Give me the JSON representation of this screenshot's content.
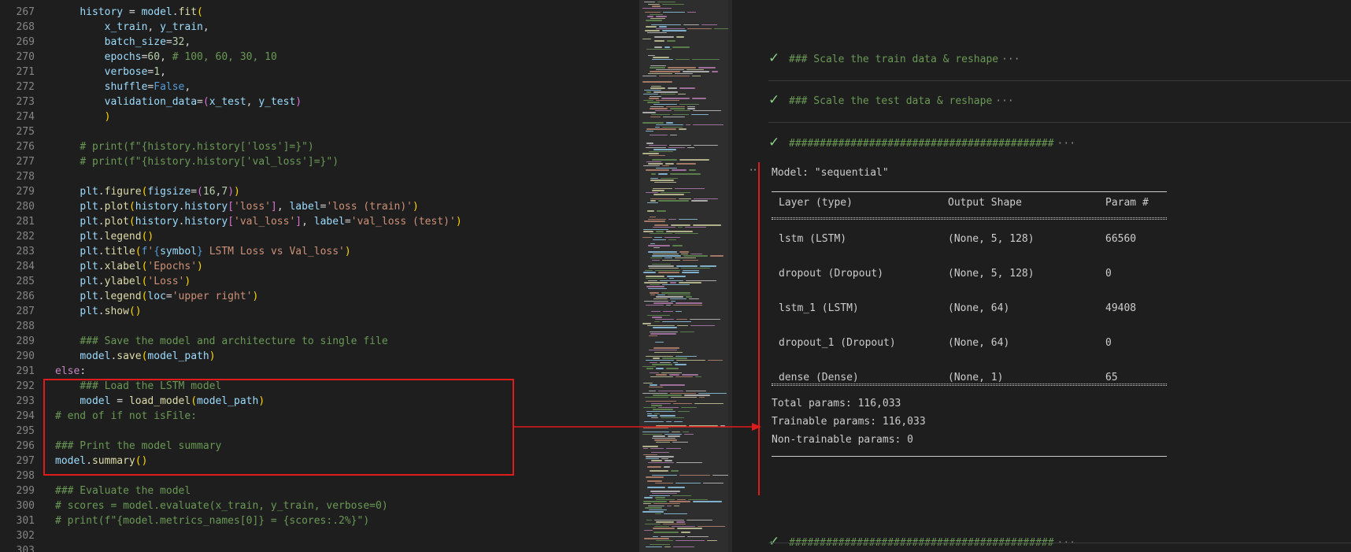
{
  "editor": {
    "lines": [
      {
        "n": "267",
        "tokens": [
          [
            "p",
            "    "
          ],
          [
            "var",
            "history"
          ],
          [
            "p",
            " = "
          ],
          [
            "var",
            "model"
          ],
          [
            "p",
            "."
          ],
          [
            "fn",
            "fit"
          ],
          [
            "br1",
            "("
          ]
        ]
      },
      {
        "n": "268",
        "tokens": [
          [
            "p",
            "        "
          ],
          [
            "var",
            "x_train"
          ],
          [
            "p",
            ", "
          ],
          [
            "var",
            "y_train"
          ],
          [
            "p",
            ","
          ]
        ]
      },
      {
        "n": "269",
        "tokens": [
          [
            "p",
            "        "
          ],
          [
            "var",
            "batch_size"
          ],
          [
            "p",
            "="
          ],
          [
            "num",
            "32"
          ],
          [
            "p",
            ","
          ]
        ]
      },
      {
        "n": "270",
        "tokens": [
          [
            "p",
            "        "
          ],
          [
            "var",
            "epochs"
          ],
          [
            "p",
            "="
          ],
          [
            "num",
            "60"
          ],
          [
            "p",
            ", "
          ],
          [
            "cm",
            "# 100, 60, 30, 10"
          ]
        ]
      },
      {
        "n": "271",
        "tokens": [
          [
            "p",
            "        "
          ],
          [
            "var",
            "verbose"
          ],
          [
            "p",
            "="
          ],
          [
            "num",
            "1"
          ],
          [
            "p",
            ","
          ]
        ]
      },
      {
        "n": "272",
        "tokens": [
          [
            "p",
            "        "
          ],
          [
            "var",
            "shuffle"
          ],
          [
            "p",
            "="
          ],
          [
            "const",
            "False"
          ],
          [
            "p",
            ","
          ]
        ]
      },
      {
        "n": "273",
        "tokens": [
          [
            "p",
            "        "
          ],
          [
            "var",
            "validation_data"
          ],
          [
            "p",
            "="
          ],
          [
            "br2",
            "("
          ],
          [
            "var",
            "x_test"
          ],
          [
            "p",
            ", "
          ],
          [
            "var",
            "y_test"
          ],
          [
            "br2",
            ")"
          ]
        ]
      },
      {
        "n": "274",
        "tokens": [
          [
            "p",
            "        "
          ],
          [
            "br1",
            ")"
          ]
        ]
      },
      {
        "n": "275",
        "tokens": []
      },
      {
        "n": "276",
        "tokens": [
          [
            "p",
            "    "
          ],
          [
            "cm",
            "# print(f\"{history.history['loss']=}\")"
          ]
        ]
      },
      {
        "n": "277",
        "tokens": [
          [
            "p",
            "    "
          ],
          [
            "cm",
            "# print(f\"{history.history['val_loss']=}\")"
          ]
        ]
      },
      {
        "n": "278",
        "tokens": []
      },
      {
        "n": "279",
        "tokens": [
          [
            "p",
            "    "
          ],
          [
            "var",
            "plt"
          ],
          [
            "p",
            "."
          ],
          [
            "fn",
            "figure"
          ],
          [
            "br1",
            "("
          ],
          [
            "var",
            "figsize"
          ],
          [
            "p",
            "="
          ],
          [
            "br2",
            "("
          ],
          [
            "num",
            "16"
          ],
          [
            "p",
            ","
          ],
          [
            "num",
            "7"
          ],
          [
            "br2",
            ")"
          ],
          [
            "br1",
            ")"
          ]
        ]
      },
      {
        "n": "280",
        "tokens": [
          [
            "p",
            "    "
          ],
          [
            "var",
            "plt"
          ],
          [
            "p",
            "."
          ],
          [
            "fn",
            "plot"
          ],
          [
            "br1",
            "("
          ],
          [
            "var",
            "history"
          ],
          [
            "p",
            "."
          ],
          [
            "var",
            "history"
          ],
          [
            "br2",
            "["
          ],
          [
            "str",
            "'loss'"
          ],
          [
            "br2",
            "]"
          ],
          [
            "p",
            ", "
          ],
          [
            "var",
            "label"
          ],
          [
            "p",
            "="
          ],
          [
            "str",
            "'loss (train)'"
          ],
          [
            "br1",
            ")"
          ]
        ]
      },
      {
        "n": "281",
        "tokens": [
          [
            "p",
            "    "
          ],
          [
            "var",
            "plt"
          ],
          [
            "p",
            "."
          ],
          [
            "fn",
            "plot"
          ],
          [
            "br1",
            "("
          ],
          [
            "var",
            "history"
          ],
          [
            "p",
            "."
          ],
          [
            "var",
            "history"
          ],
          [
            "br2",
            "["
          ],
          [
            "str",
            "'val_loss'"
          ],
          [
            "br2",
            "]"
          ],
          [
            "p",
            ", "
          ],
          [
            "var",
            "label"
          ],
          [
            "p",
            "="
          ],
          [
            "str",
            "'val_loss (test)'"
          ],
          [
            "br1",
            ")"
          ]
        ]
      },
      {
        "n": "282",
        "tokens": [
          [
            "p",
            "    "
          ],
          [
            "var",
            "plt"
          ],
          [
            "p",
            "."
          ],
          [
            "fn",
            "legend"
          ],
          [
            "br1",
            "()"
          ]
        ]
      },
      {
        "n": "283",
        "tokens": [
          [
            "p",
            "    "
          ],
          [
            "var",
            "plt"
          ],
          [
            "p",
            "."
          ],
          [
            "fn",
            "title"
          ],
          [
            "br1",
            "("
          ],
          [
            "const",
            "f"
          ],
          [
            "str",
            "'"
          ],
          [
            "const",
            "{"
          ],
          [
            "var",
            "symbol"
          ],
          [
            "const",
            "}"
          ],
          [
            "str",
            " LSTM Loss vs Val_loss'"
          ],
          [
            "br1",
            ")"
          ]
        ]
      },
      {
        "n": "284",
        "tokens": [
          [
            "p",
            "    "
          ],
          [
            "var",
            "plt"
          ],
          [
            "p",
            "."
          ],
          [
            "fn",
            "xlabel"
          ],
          [
            "br1",
            "("
          ],
          [
            "str",
            "'Epochs'"
          ],
          [
            "br1",
            ")"
          ]
        ]
      },
      {
        "n": "285",
        "tokens": [
          [
            "p",
            "    "
          ],
          [
            "var",
            "plt"
          ],
          [
            "p",
            "."
          ],
          [
            "fn",
            "ylabel"
          ],
          [
            "br1",
            "("
          ],
          [
            "str",
            "'Loss'"
          ],
          [
            "br1",
            ")"
          ]
        ]
      },
      {
        "n": "286",
        "tokens": [
          [
            "p",
            "    "
          ],
          [
            "var",
            "plt"
          ],
          [
            "p",
            "."
          ],
          [
            "fn",
            "legend"
          ],
          [
            "br1",
            "("
          ],
          [
            "var",
            "loc"
          ],
          [
            "p",
            "="
          ],
          [
            "str",
            "'upper right'"
          ],
          [
            "br1",
            ")"
          ]
        ]
      },
      {
        "n": "287",
        "tokens": [
          [
            "p",
            "    "
          ],
          [
            "var",
            "plt"
          ],
          [
            "p",
            "."
          ],
          [
            "fn",
            "show"
          ],
          [
            "br1",
            "()"
          ]
        ]
      },
      {
        "n": "288",
        "tokens": []
      },
      {
        "n": "289",
        "tokens": [
          [
            "p",
            "    "
          ],
          [
            "cm",
            "### Save the model and architecture to single file"
          ]
        ]
      },
      {
        "n": "290",
        "tokens": [
          [
            "p",
            "    "
          ],
          [
            "var",
            "model"
          ],
          [
            "p",
            "."
          ],
          [
            "fn",
            "save"
          ],
          [
            "br1",
            "("
          ],
          [
            "var",
            "model_path"
          ],
          [
            "br1",
            ")"
          ]
        ]
      },
      {
        "n": "291",
        "tokens": [
          [
            "kw",
            "else"
          ],
          [
            "p",
            ":"
          ]
        ]
      },
      {
        "n": "292",
        "tokens": [
          [
            "p",
            "    "
          ],
          [
            "cm",
            "### Load the LSTM model"
          ]
        ]
      },
      {
        "n": "293",
        "tokens": [
          [
            "p",
            "    "
          ],
          [
            "var",
            "model"
          ],
          [
            "p",
            " = "
          ],
          [
            "fn",
            "load_model"
          ],
          [
            "br1",
            "("
          ],
          [
            "var",
            "model_path"
          ],
          [
            "br1",
            ")"
          ]
        ]
      },
      {
        "n": "294",
        "tokens": [
          [
            "cm",
            "# end of if not isFile:"
          ]
        ]
      },
      {
        "n": "295",
        "tokens": []
      },
      {
        "n": "296",
        "tokens": [
          [
            "cm",
            "### Print the model summary"
          ]
        ]
      },
      {
        "n": "297",
        "tokens": [
          [
            "var",
            "model"
          ],
          [
            "p",
            "."
          ],
          [
            "fn",
            "summary"
          ],
          [
            "br1",
            "()"
          ]
        ]
      },
      {
        "n": "298",
        "tokens": []
      },
      {
        "n": "299",
        "tokens": [
          [
            "cm",
            "### Evaluate the model"
          ]
        ]
      },
      {
        "n": "300",
        "tokens": [
          [
            "cm",
            "# scores = model.evaluate(x_train, y_train, verbose=0)"
          ]
        ]
      },
      {
        "n": "301",
        "tokens": [
          [
            "cm",
            "# print(f\"{model.metrics_names[0]} = {scores:.2%}\")"
          ]
        ]
      },
      {
        "n": "302",
        "tokens": []
      },
      {
        "n": "303",
        "tokens": []
      }
    ]
  },
  "notebook": {
    "collapsed_cells": [
      {
        "check": "✓",
        "text": "### Scale the train data & reshape",
        "dots": "···"
      },
      {
        "check": "✓",
        "text": "### Scale the test data & reshape",
        "dots": "···"
      },
      {
        "check": "✓",
        "text": "###########################################",
        "dots": "···"
      },
      {
        "check": "✓",
        "text": "###########################################",
        "dots": "···"
      }
    ],
    "output_more_icon": "···",
    "summary": {
      "model_line": "Model: \"sequential\"",
      "headers": [
        "Layer (type)",
        "Output Shape",
        "Param #"
      ],
      "rows": [
        [
          "lstm (LSTM)",
          "(None, 5, 128)",
          "66560"
        ],
        [
          "dropout (Dropout)",
          "(None, 5, 128)",
          "0"
        ],
        [
          "lstm_1 (LSTM)",
          "(None, 64)",
          "49408"
        ],
        [
          "dropout_1 (Dropout)",
          "(None, 64)",
          "0"
        ],
        [
          "dense (Dense)",
          "(None, 1)",
          "65"
        ]
      ],
      "total": "Total params: 116,033",
      "trainable": "Trainable params: 116,033",
      "non_trainable": "Non-trainable params: 0"
    }
  },
  "colors": {
    "annotation_red": "#e01b1b",
    "check_green": "#89d185",
    "comment_green": "#6a9955"
  }
}
